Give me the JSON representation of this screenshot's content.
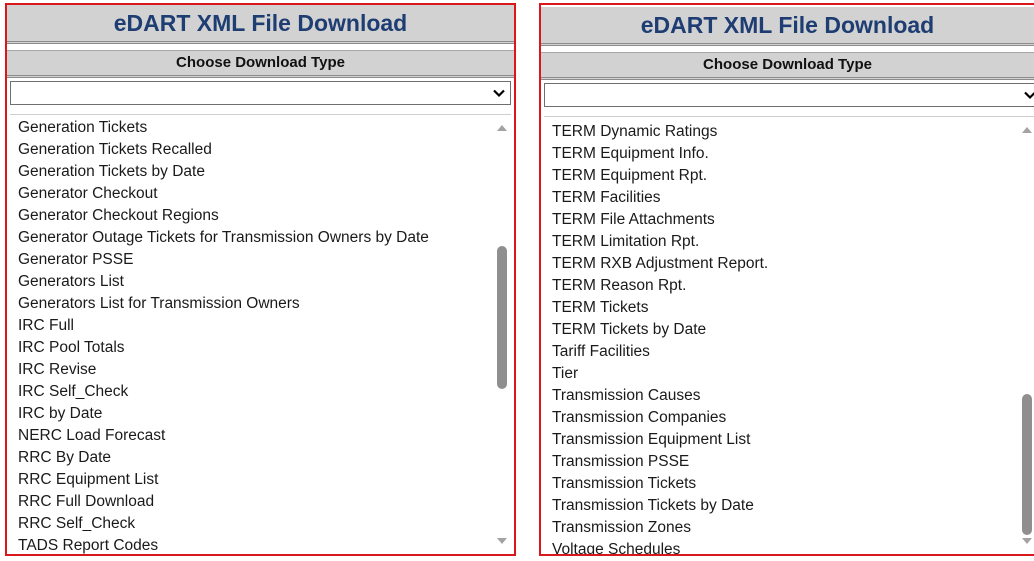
{
  "left_panel": {
    "title": "eDART XML File Download",
    "subtitle": "Choose Download Type",
    "select_value": "",
    "items": [
      "Generation Tickets",
      "Generation Tickets Recalled",
      "Generation Tickets by Date",
      "Generator Checkout",
      "Generator Checkout Regions",
      "Generator Outage Tickets for Transmission Owners by Date",
      "Generator PSSE",
      "Generators List",
      "Generators List for Transmission Owners",
      "IRC Full",
      "IRC Pool Totals",
      "IRC Revise",
      "IRC Self_Check",
      "IRC by Date",
      "NERC Load Forecast",
      "RRC By Date",
      "RRC Equipment List",
      "RRC Full Download",
      "RRC Self_Check",
      "TADS Report Codes"
    ]
  },
  "right_panel": {
    "title": "eDART XML File Download",
    "subtitle": "Choose Download Type",
    "select_value": "",
    "items": [
      "TERM Dynamic Ratings",
      "TERM Equipment Info.",
      "TERM Equipment Rpt.",
      "TERM Facilities",
      "TERM File Attachments",
      "TERM Limitation Rpt.",
      "TERM RXB Adjustment Report.",
      "TERM Reason Rpt.",
      "TERM Tickets",
      "TERM Tickets by Date",
      "Tariff Facilities",
      "Tier",
      "Transmission Causes",
      "Transmission Companies",
      "Transmission Equipment List",
      "Transmission PSSE",
      "Transmission Tickets",
      "Transmission Tickets by Date",
      "Transmission Zones",
      "Voltage Schedules"
    ]
  },
  "colors": {
    "highlight_border": "#d9181c",
    "title_text": "#1e3d72",
    "header_bg": "#d2d2d2"
  },
  "icons": {
    "select_arrow": "chevron-down-icon",
    "scroll_up": "scroll-up-arrow-icon",
    "scroll_down": "scroll-down-arrow-icon"
  }
}
